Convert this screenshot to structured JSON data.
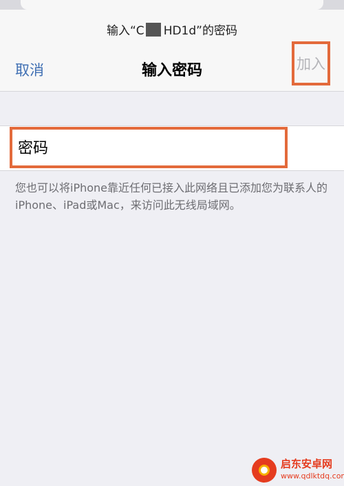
{
  "header": {
    "subtitle_prefix": "输入“C",
    "subtitle_suffix": "HD1d”的密码",
    "cancel_label": "取消",
    "title": "输入密码",
    "join_label": "加入"
  },
  "password_field": {
    "placeholder": "密码",
    "value": ""
  },
  "footer_note": "您也可以将iPhone靠近任何已接入此网络且已添加您为联系人的iPhone、iPad或Mac，来访问此无线局域网。",
  "watermark": {
    "brand": "启东安卓网",
    "url": "www.qdlktdq.com"
  },
  "colors": {
    "accent_blue": "#3f6fb3",
    "highlight_orange": "#e36a3b",
    "disabled_gray": "#b5b5b9",
    "background": "#efeff4"
  }
}
